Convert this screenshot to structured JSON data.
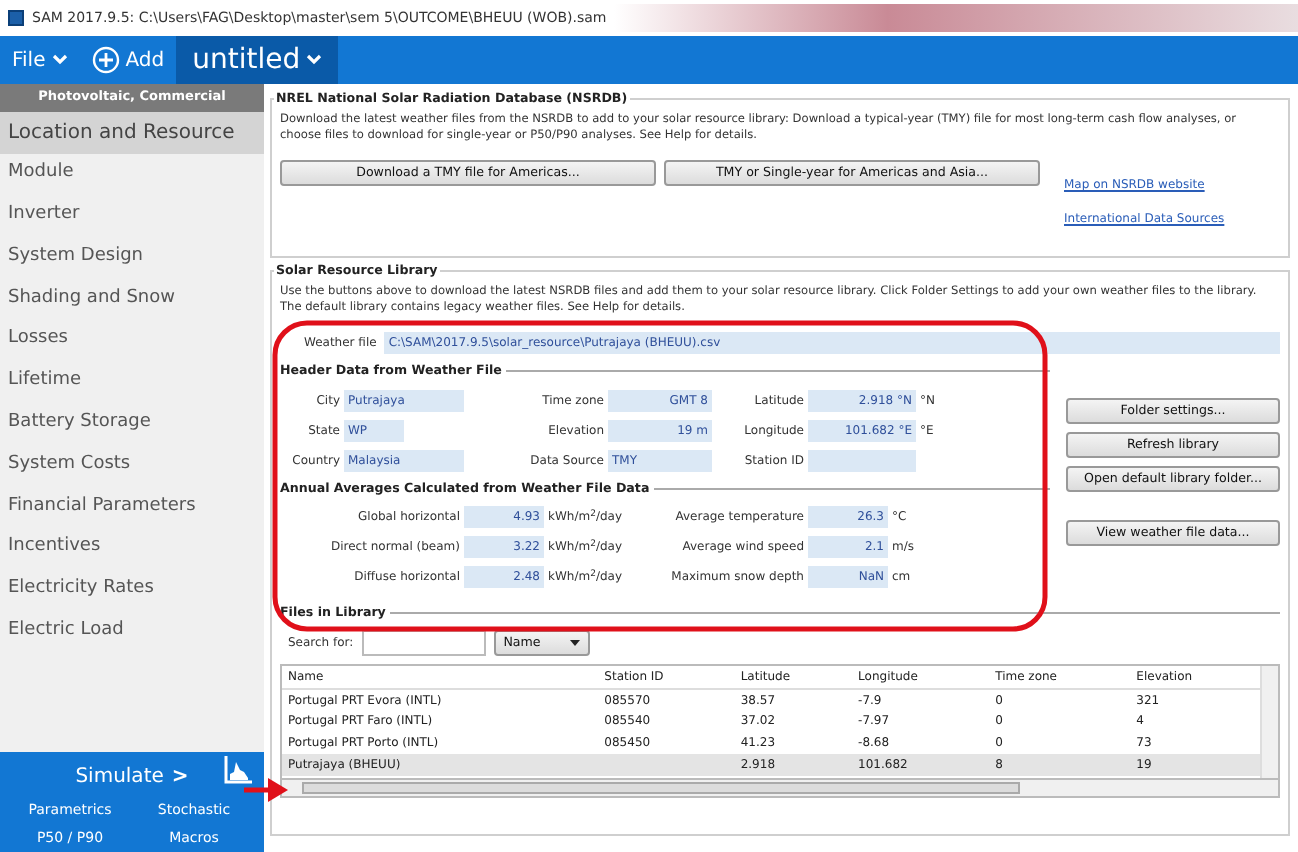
{
  "window": {
    "title": "SAM 2017.9.5: C:\\Users\\FAG\\Desktop\\master\\sem 5\\OUTCOME\\BHEUU (WOB).sam"
  },
  "toolbar": {
    "file": "File",
    "add": "Add",
    "case": "untitled"
  },
  "sidebar": {
    "header": "Photovoltaic, Commercial",
    "items": [
      {
        "label": "Location and Resource",
        "selected": true
      },
      {
        "label": "Module",
        "selected": false
      },
      {
        "label": "Inverter",
        "selected": false
      },
      {
        "label": "System Design",
        "selected": false
      },
      {
        "label": "Shading and Snow",
        "selected": false
      },
      {
        "label": "Losses",
        "selected": false
      },
      {
        "label": "Lifetime",
        "selected": false
      },
      {
        "label": "Battery Storage",
        "selected": false
      },
      {
        "label": "System Costs",
        "selected": false
      },
      {
        "label": "Financial Parameters",
        "selected": false
      },
      {
        "label": "Incentives",
        "selected": false
      },
      {
        "label": "Electricity Rates",
        "selected": false
      },
      {
        "label": "Electric Load",
        "selected": false
      }
    ],
    "simulate": "Simulate",
    "simulate_arrow": ">",
    "links": [
      "Parametrics",
      "Stochastic",
      "P50 / P90",
      "Macros"
    ]
  },
  "nsrdb": {
    "title": "NREL National Solar Radiation Database (NSRDB)",
    "description": "Download the latest weather files from the NSRDB to add to your solar resource library: Download a typical-year (TMY) file for most long-term cash flow analyses, or choose files to download for single-year or P50/P90 analyses. See Help for details.",
    "buttons": [
      "Download a TMY file for Americas...",
      "TMY or Single-year for Americas and Asia..."
    ],
    "links": [
      "Map on NSRDB website",
      "International Data Sources"
    ]
  },
  "library": {
    "title": "Solar Resource Library",
    "description": "Use the buttons above to download the latest NSRDB files and add them to your solar resource library. Click Folder Settings to add your own weather files to the library. The default library contains legacy weather files. See Help for details.",
    "weather_file_label": "Weather file",
    "weather_file": "C:\\SAM\\2017.9.5\\solar_resource\\Putrajaya (BHEUU).csv",
    "header_title": "Header Data from Weather File",
    "header_rows": [
      [
        {
          "label": "City",
          "value": "Putrajaya",
          "kind": "text"
        },
        {
          "label": "Time zone",
          "value": "GMT 8",
          "kind": "number"
        },
        {
          "label": "Latitude",
          "value": "2.918 °N",
          "kind": "number",
          "unit": "°N"
        }
      ],
      [
        {
          "label": "State",
          "value": "WP",
          "kind": "text"
        },
        {
          "label": "Elevation",
          "value": "19 m",
          "kind": "number"
        },
        {
          "label": "Longitude",
          "value": "101.682 °E",
          "kind": "number",
          "unit": "°E"
        }
      ],
      [
        {
          "label": "Country",
          "value": "Malaysia",
          "kind": "text"
        },
        {
          "label": "Data Source",
          "value": "TMY",
          "kind": "text"
        },
        {
          "label": "Station ID",
          "kind": "text"
        }
      ]
    ],
    "side_buttons": [
      "Folder settings...",
      "Refresh library",
      "Open default library folder...",
      "View weather file data..."
    ],
    "averages_title": "Annual Averages Calculated from Weather File  Data",
    "averages_rows": [
      [
        {
          "label": "Global horizontal",
          "value": "4.93",
          "unit": "kWh/m$^{2}$/day"
        },
        {
          "label": "Average temperature",
          "value": "26.3",
          "unit": "°C"
        }
      ],
      [
        {
          "label": "Direct normal (beam)",
          "value": "3.22",
          "unit": "kWh/m$^{2}$/day"
        },
        {
          "label": "Average wind speed",
          "value": "2.1",
          "unit": "m/s"
        }
      ],
      [
        {
          "label": "Diffuse horizontal",
          "value": "2.48",
          "unit": "kWh/m$^{2}$/day"
        },
        {
          "label": "Maximum snow depth",
          "value": "NaN",
          "unit": "cm"
        }
      ]
    ],
    "files_title": "Files in Library",
    "search_label": "Search for:",
    "search_mode": "Name",
    "table": {
      "columns": [
        "Name",
        "Station ID",
        "Latitude",
        "Longitude",
        "Time zone",
        "Elevation"
      ],
      "rows": [
        {
          "cells": [
            "Portugal PRT Evora (INTL)",
            "085570",
            "38.57",
            "-7.9",
            "0",
            "321"
          ],
          "selected": false
        },
        {
          "cells": [
            "Portugal PRT Faro (INTL)",
            "085540",
            "37.02",
            "-7.97",
            "0",
            "4"
          ],
          "selected": false
        },
        {
          "cells": [
            "Portugal PRT Porto (INTL)",
            "085450",
            "41.23",
            "-8.68",
            "0",
            "73"
          ],
          "selected": false
        },
        {
          "cells": [
            "Putrajaya (BHEUU)",
            "",
            "2.918",
            "101.682",
            "8",
            "19"
          ],
          "selected": true
        }
      ]
    }
  },
  "annotations": {
    "highlight_outline": true,
    "arrow": true
  }
}
